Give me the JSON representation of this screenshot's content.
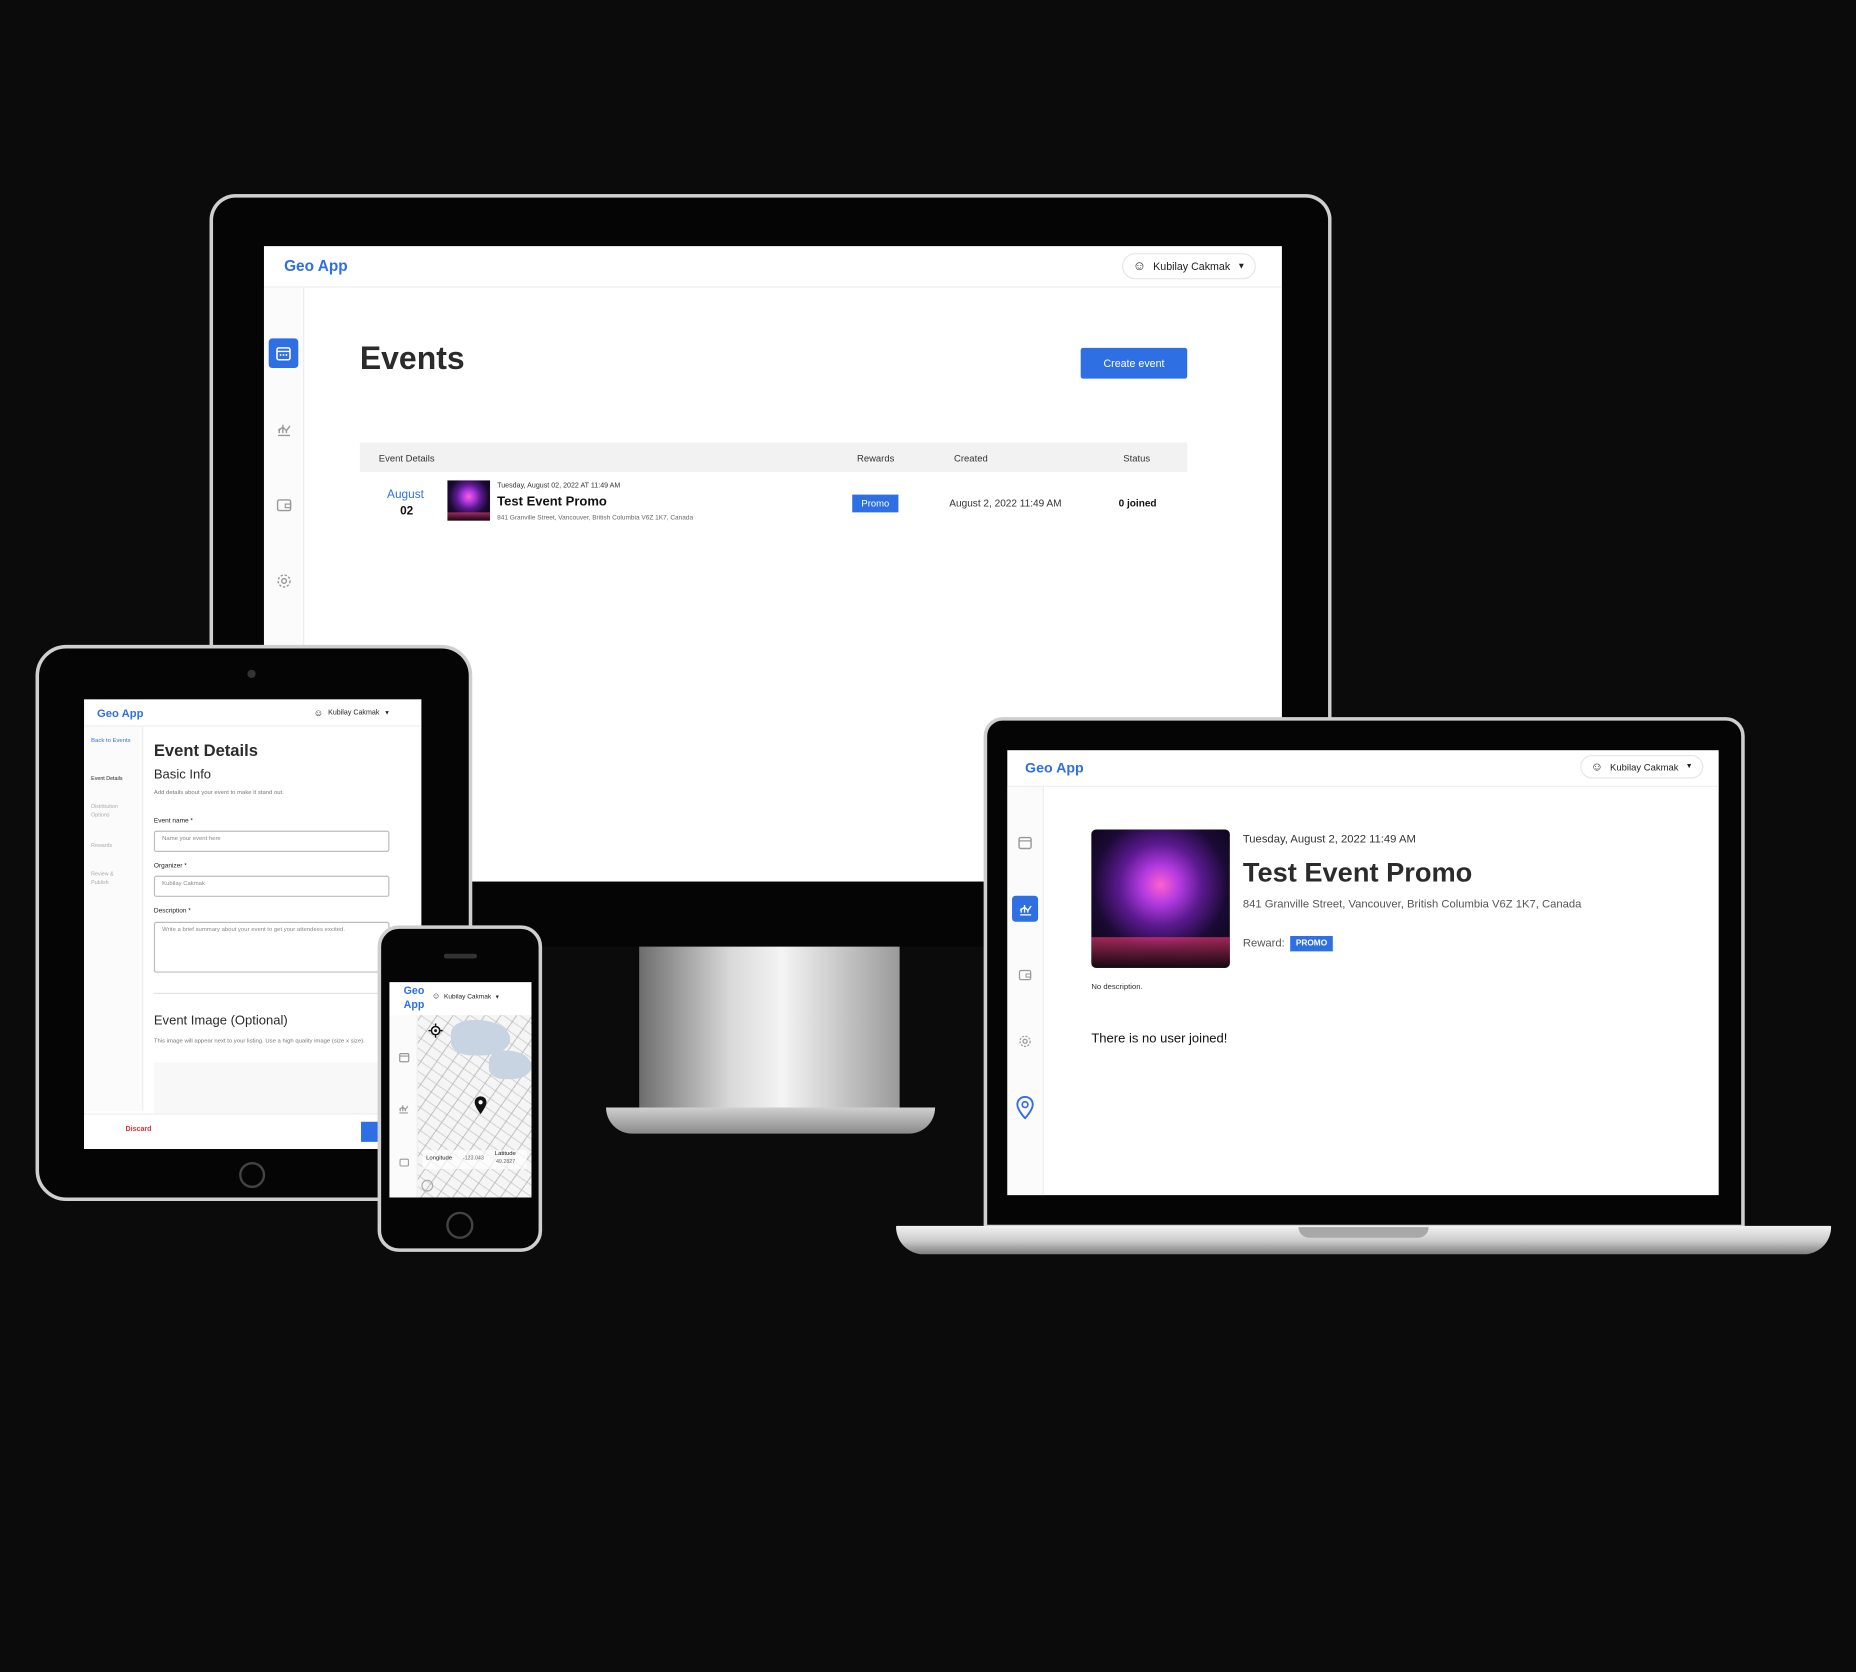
{
  "app": {
    "brand": "Geo App",
    "user_name": "Kubilay Cakmak"
  },
  "desktop": {
    "page_title": "Events",
    "create_button": "Create event",
    "table_headers": [
      "Event Details",
      "Rewards",
      "Created",
      "Status"
    ],
    "rows": [
      {
        "month": "August",
        "day": "02",
        "datetime": "Tuesday, August 02, 2022 AT 11:49 AM",
        "name": "Test Event Promo",
        "address": "841 Granville Street, Vancouver, British Columbia V6Z 1K7, Canada",
        "reward": "Promo",
        "created": "August 2, 2022 11:49 AM",
        "status": "0 joined"
      }
    ]
  },
  "tablet": {
    "side_nav": [
      "Back to Events",
      "Event Details",
      "Distribution Options",
      "Rewards",
      "Review & Publish"
    ],
    "title": "Event Details",
    "subtitle": "Basic Info",
    "help": "Add details about your event to make it stand out.",
    "event_name_label": "Event name *",
    "event_name_placeholder": "Name your event here",
    "organizer_label": "Organizer *",
    "organizer_value": "Kubilay Cakmak",
    "description_label": "Description *",
    "description_placeholder": "Write a brief summary about your event to get your attendees excited.",
    "image_title": "Event Image (Optional)",
    "image_help": "This image will appear next to your listing. Use a high quality image (size x size).",
    "discard": "Discard"
  },
  "phone": {
    "brand_line1": "Geo",
    "brand_line2": "App",
    "longitude_label": "Longitude",
    "longitude_value": "-123.043",
    "latitude_label": "Latitude",
    "latitude_value": "49.2827"
  },
  "laptop": {
    "datetime": "Tuesday, August 2, 2022 11:49 AM",
    "name": "Test Event Promo",
    "address": "841 Granville Street, Vancouver, British Columbia V6Z 1K7, Canada",
    "reward_label": "Reward:",
    "reward_value": "PROMO",
    "description": "No description.",
    "joined": "There is no user joined!"
  }
}
